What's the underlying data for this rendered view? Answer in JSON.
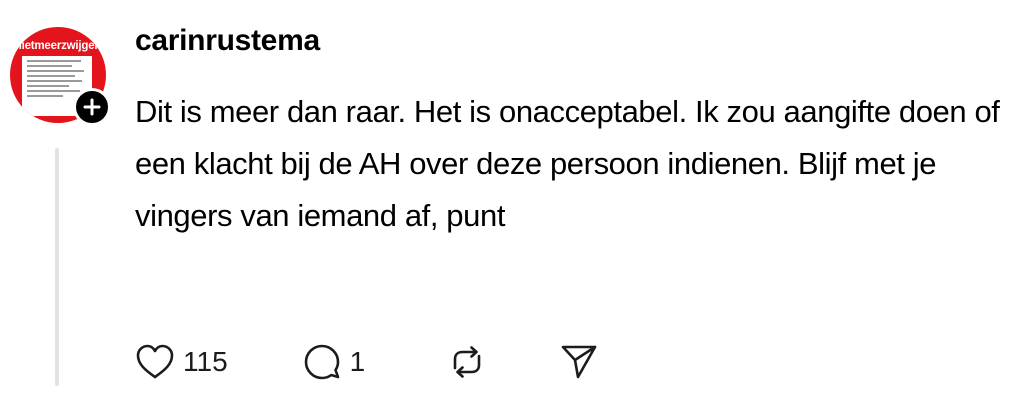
{
  "post": {
    "username": "carinrustema",
    "content": "Dit is meer dan raar. Het is onacceptabel. Ik zou aangifte doen of een klacht bij de AH over deze persoon indienen. Blijf met je vingers van iemand af, punt",
    "avatar": {
      "banner_text": "nietmeerzwijgen",
      "background_color": "#e3141c"
    },
    "follow_icon": "plus-icon",
    "actions": {
      "like": {
        "icon": "heart-icon",
        "count": "115"
      },
      "reply": {
        "icon": "comment-icon",
        "count": "1"
      },
      "repost": {
        "icon": "repost-icon"
      },
      "share": {
        "icon": "send-icon"
      }
    }
  }
}
